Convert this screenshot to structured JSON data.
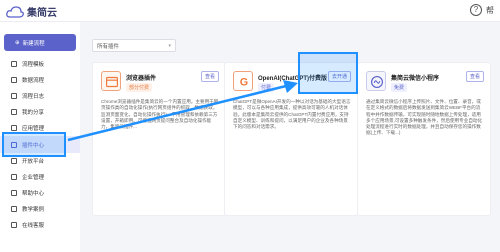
{
  "app": {
    "name": "集简云",
    "help": "帮"
  },
  "sidebar": {
    "new_button": "新建流程",
    "items": [
      {
        "label": "流程模板",
        "icon": "template-icon"
      },
      {
        "label": "数据流程",
        "icon": "flow-icon"
      },
      {
        "label": "流程日志",
        "icon": "log-icon"
      },
      {
        "label": "我的分享",
        "icon": "share-icon"
      },
      {
        "label": "应用管理",
        "icon": "app-icon"
      },
      {
        "label": "插件中心",
        "icon": "plugin-icon",
        "active": true
      },
      {
        "label": "开放平台",
        "icon": "platform-icon"
      },
      {
        "label": "企业管理",
        "icon": "enterprise-icon"
      },
      {
        "label": "帮助中心",
        "icon": "help-icon"
      },
      {
        "label": "教学案例",
        "icon": "case-icon"
      },
      {
        "label": "在线客服",
        "icon": "service-icon"
      }
    ]
  },
  "filter": {
    "value": "所有插件"
  },
  "cards": [
    {
      "title": "浏览器插件",
      "badge": "部分付费",
      "action": "查看",
      "desc": "Chrome浏览器插件是集简云的一个内置应用。主要用于网页操作类的自动化操作(执行网页组件的抓取，数据获取，监测页面变化，自动化操作执行)，不用管理和依赖第三方设置，开箱即用。可增强网页提问整合及自动化操作能力，集简云插件..."
    },
    {
      "title": "OpenAI(ChatGPT)付费版",
      "badge": "付费",
      "action": "去开通",
      "desc": "ChatGPT是微OpenAI开发的一种以对话为基础的大型语言模型，可以与各种应用集成，提供高效可靠的人机对话体验。此版本是集简云提供的ChatGPT内置付费应用，支持自定义模型、训练和提问，以满足用户的企业及各种场景下的问答和对话需求。"
    },
    {
      "title": "集简云微信小程序",
      "badge": "免费",
      "action": "查看",
      "desc": "通过集简云微信小程序上传照片、文件、位置、录音，或在定义格式的数据后将数据发送到集简云WEBF平台的流程中并作数据传输，可实现随时随地数据上传处理，适用多个应用场景,可设置多种触发条件，然后使用专业自动化处理流程进行实时的数据处理，并且自动保存您的操作数据(上传、下载...)"
    }
  ]
}
